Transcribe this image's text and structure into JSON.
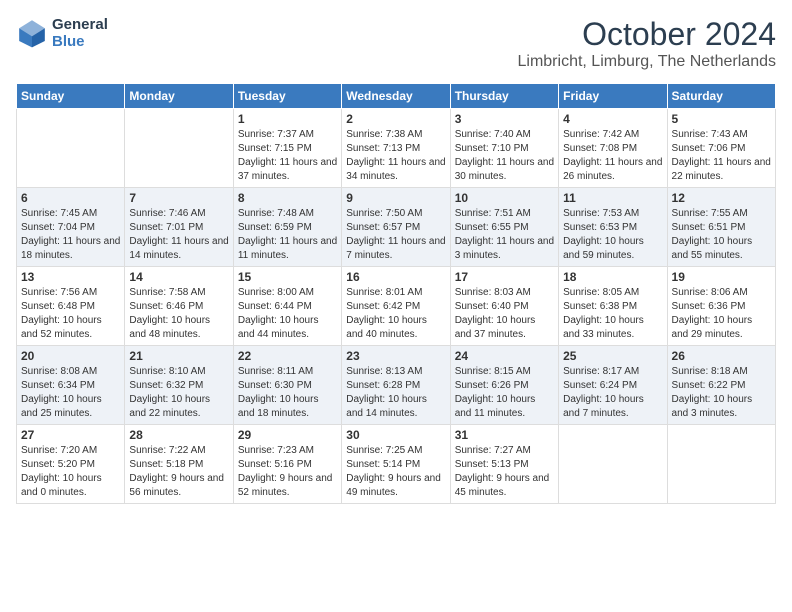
{
  "logo": {
    "line1": "General",
    "line2": "Blue"
  },
  "title": "October 2024",
  "subtitle": "Limbricht, Limburg, The Netherlands",
  "weekdays": [
    "Sunday",
    "Monday",
    "Tuesday",
    "Wednesday",
    "Thursday",
    "Friday",
    "Saturday"
  ],
  "weeks": [
    [
      {
        "day": "",
        "content": ""
      },
      {
        "day": "",
        "content": ""
      },
      {
        "day": "1",
        "content": "Sunrise: 7:37 AM\nSunset: 7:15 PM\nDaylight: 11 hours and 37 minutes."
      },
      {
        "day": "2",
        "content": "Sunrise: 7:38 AM\nSunset: 7:13 PM\nDaylight: 11 hours and 34 minutes."
      },
      {
        "day": "3",
        "content": "Sunrise: 7:40 AM\nSunset: 7:10 PM\nDaylight: 11 hours and 30 minutes."
      },
      {
        "day": "4",
        "content": "Sunrise: 7:42 AM\nSunset: 7:08 PM\nDaylight: 11 hours and 26 minutes."
      },
      {
        "day": "5",
        "content": "Sunrise: 7:43 AM\nSunset: 7:06 PM\nDaylight: 11 hours and 22 minutes."
      }
    ],
    [
      {
        "day": "6",
        "content": "Sunrise: 7:45 AM\nSunset: 7:04 PM\nDaylight: 11 hours and 18 minutes."
      },
      {
        "day": "7",
        "content": "Sunrise: 7:46 AM\nSunset: 7:01 PM\nDaylight: 11 hours and 14 minutes."
      },
      {
        "day": "8",
        "content": "Sunrise: 7:48 AM\nSunset: 6:59 PM\nDaylight: 11 hours and 11 minutes."
      },
      {
        "day": "9",
        "content": "Sunrise: 7:50 AM\nSunset: 6:57 PM\nDaylight: 11 hours and 7 minutes."
      },
      {
        "day": "10",
        "content": "Sunrise: 7:51 AM\nSunset: 6:55 PM\nDaylight: 11 hours and 3 minutes."
      },
      {
        "day": "11",
        "content": "Sunrise: 7:53 AM\nSunset: 6:53 PM\nDaylight: 10 hours and 59 minutes."
      },
      {
        "day": "12",
        "content": "Sunrise: 7:55 AM\nSunset: 6:51 PM\nDaylight: 10 hours and 55 minutes."
      }
    ],
    [
      {
        "day": "13",
        "content": "Sunrise: 7:56 AM\nSunset: 6:48 PM\nDaylight: 10 hours and 52 minutes."
      },
      {
        "day": "14",
        "content": "Sunrise: 7:58 AM\nSunset: 6:46 PM\nDaylight: 10 hours and 48 minutes."
      },
      {
        "day": "15",
        "content": "Sunrise: 8:00 AM\nSunset: 6:44 PM\nDaylight: 10 hours and 44 minutes."
      },
      {
        "day": "16",
        "content": "Sunrise: 8:01 AM\nSunset: 6:42 PM\nDaylight: 10 hours and 40 minutes."
      },
      {
        "day": "17",
        "content": "Sunrise: 8:03 AM\nSunset: 6:40 PM\nDaylight: 10 hours and 37 minutes."
      },
      {
        "day": "18",
        "content": "Sunrise: 8:05 AM\nSunset: 6:38 PM\nDaylight: 10 hours and 33 minutes."
      },
      {
        "day": "19",
        "content": "Sunrise: 8:06 AM\nSunset: 6:36 PM\nDaylight: 10 hours and 29 minutes."
      }
    ],
    [
      {
        "day": "20",
        "content": "Sunrise: 8:08 AM\nSunset: 6:34 PM\nDaylight: 10 hours and 25 minutes."
      },
      {
        "day": "21",
        "content": "Sunrise: 8:10 AM\nSunset: 6:32 PM\nDaylight: 10 hours and 22 minutes."
      },
      {
        "day": "22",
        "content": "Sunrise: 8:11 AM\nSunset: 6:30 PM\nDaylight: 10 hours and 18 minutes."
      },
      {
        "day": "23",
        "content": "Sunrise: 8:13 AM\nSunset: 6:28 PM\nDaylight: 10 hours and 14 minutes."
      },
      {
        "day": "24",
        "content": "Sunrise: 8:15 AM\nSunset: 6:26 PM\nDaylight: 10 hours and 11 minutes."
      },
      {
        "day": "25",
        "content": "Sunrise: 8:17 AM\nSunset: 6:24 PM\nDaylight: 10 hours and 7 minutes."
      },
      {
        "day": "26",
        "content": "Sunrise: 8:18 AM\nSunset: 6:22 PM\nDaylight: 10 hours and 3 minutes."
      }
    ],
    [
      {
        "day": "27",
        "content": "Sunrise: 7:20 AM\nSunset: 5:20 PM\nDaylight: 10 hours and 0 minutes."
      },
      {
        "day": "28",
        "content": "Sunrise: 7:22 AM\nSunset: 5:18 PM\nDaylight: 9 hours and 56 minutes."
      },
      {
        "day": "29",
        "content": "Sunrise: 7:23 AM\nSunset: 5:16 PM\nDaylight: 9 hours and 52 minutes."
      },
      {
        "day": "30",
        "content": "Sunrise: 7:25 AM\nSunset: 5:14 PM\nDaylight: 9 hours and 49 minutes."
      },
      {
        "day": "31",
        "content": "Sunrise: 7:27 AM\nSunset: 5:13 PM\nDaylight: 9 hours and 45 minutes."
      },
      {
        "day": "",
        "content": ""
      },
      {
        "day": "",
        "content": ""
      }
    ]
  ]
}
